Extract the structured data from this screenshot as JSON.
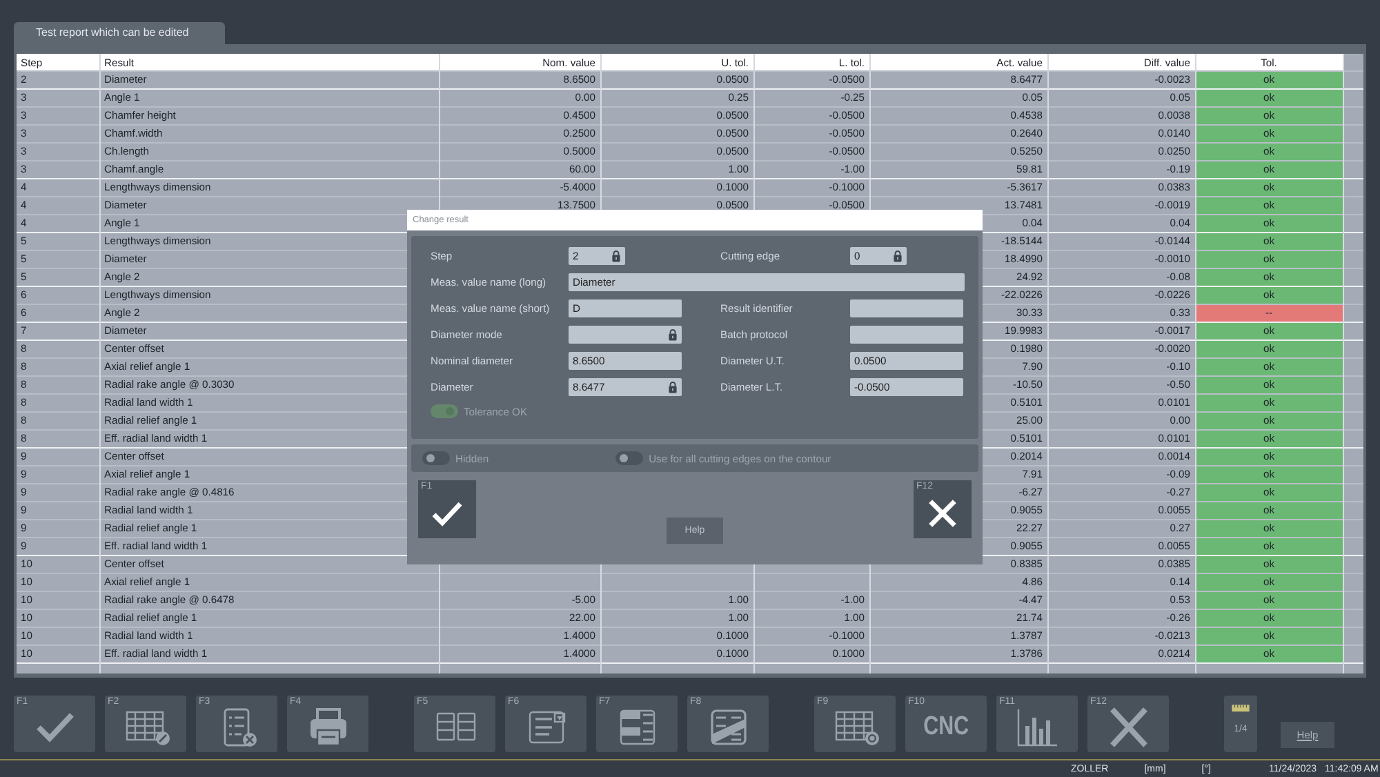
{
  "tab": {
    "label": "Test report which can be edited",
    "selected": true
  },
  "table": {
    "columns": [
      "Step",
      "Result",
      "Nom. value",
      "U. tol.",
      "L. tol.",
      "Act. value",
      "Diff. value",
      "Tol."
    ],
    "rows": [
      {
        "cells": [
          "2",
          "Diameter",
          "8.6500",
          "0.0500",
          "-0.0500",
          "8.6477",
          "-0.0023",
          "ok"
        ],
        "in_tolerance": true
      },
      {
        "cells": [
          "3",
          "Angle 1",
          "0.00",
          "0.25",
          "-0.25",
          "0.05",
          "0.05",
          "ok"
        ],
        "in_tolerance": true
      },
      {
        "cells": [
          "3",
          "Chamfer height",
          "0.4500",
          "0.0500",
          "-0.0500",
          "0.4538",
          "0.0038",
          "ok"
        ],
        "in_tolerance": true
      },
      {
        "cells": [
          "3",
          "Chamf.width",
          "0.2500",
          "0.0500",
          "-0.0500",
          "0.2640",
          "0.0140",
          "ok"
        ],
        "in_tolerance": true
      },
      {
        "cells": [
          "3",
          "Ch.length",
          "0.5000",
          "0.0500",
          "-0.0500",
          "0.5250",
          "0.0250",
          "ok"
        ],
        "in_tolerance": true
      },
      {
        "cells": [
          "3",
          "Chamf.angle",
          "60.00",
          "1.00",
          "-1.00",
          "59.81",
          "-0.19",
          "ok"
        ],
        "in_tolerance": true
      },
      {
        "cells": [
          "4",
          "Lengthways dimension",
          "-5.4000",
          "0.1000",
          "-0.1000",
          "-5.3617",
          "0.0383",
          "ok"
        ],
        "in_tolerance": true
      },
      {
        "cells": [
          "4",
          "Diameter",
          "13.7500",
          "0.0500",
          "-0.0500",
          "13.7481",
          "-0.0019",
          "ok"
        ],
        "in_tolerance": true
      },
      {
        "cells": [
          "4",
          "Angle 1",
          null,
          null,
          null,
          "0.04",
          "0.04",
          "ok"
        ],
        "in_tolerance": true
      },
      {
        "cells": [
          "5",
          "Lengthways dimension",
          null,
          null,
          null,
          "-18.5144",
          "-0.0144",
          "ok"
        ],
        "in_tolerance": true
      },
      {
        "cells": [
          "5",
          "Diameter",
          null,
          null,
          null,
          "18.4990",
          "-0.0010",
          "ok"
        ],
        "in_tolerance": true
      },
      {
        "cells": [
          "5",
          "Angle 2",
          null,
          null,
          null,
          "24.92",
          "-0.08",
          "ok"
        ],
        "in_tolerance": true
      },
      {
        "cells": [
          "6",
          "Lengthways dimension",
          null,
          null,
          null,
          "-22.0226",
          "-0.0226",
          "ok"
        ],
        "in_tolerance": true
      },
      {
        "cells": [
          "6",
          "Angle 2",
          null,
          null,
          null,
          "30.33",
          "0.33",
          "--"
        ],
        "in_tolerance": false
      },
      {
        "cells": [
          "7",
          "Diameter",
          null,
          null,
          null,
          "19.9983",
          "-0.0017",
          "ok"
        ],
        "in_tolerance": true
      },
      {
        "cells": [
          "8",
          "Center offset",
          null,
          null,
          null,
          "0.1980",
          "-0.0020",
          "ok"
        ],
        "in_tolerance": true
      },
      {
        "cells": [
          "8",
          "Axial relief angle 1",
          null,
          null,
          null,
          "7.90",
          "-0.10",
          "ok"
        ],
        "in_tolerance": true
      },
      {
        "cells": [
          "8",
          "Radial rake angle @ 0.3030",
          null,
          null,
          null,
          "-10.50",
          "-0.50",
          "ok"
        ],
        "in_tolerance": true
      },
      {
        "cells": [
          "8",
          "Radial land width 1",
          null,
          null,
          null,
          "0.5101",
          "0.0101",
          "ok"
        ],
        "in_tolerance": true
      },
      {
        "cells": [
          "8",
          "Radial relief angle 1",
          null,
          null,
          null,
          "25.00",
          "0.00",
          "ok"
        ],
        "in_tolerance": true
      },
      {
        "cells": [
          "8",
          "Eff. radial land width 1",
          null,
          null,
          null,
          "0.5101",
          "0.0101",
          "ok"
        ],
        "in_tolerance": true
      },
      {
        "cells": [
          "9",
          "Center offset",
          null,
          null,
          null,
          "0.2014",
          "0.0014",
          "ok"
        ],
        "in_tolerance": true
      },
      {
        "cells": [
          "9",
          "Axial relief angle 1",
          null,
          null,
          null,
          "7.91",
          "-0.09",
          "ok"
        ],
        "in_tolerance": true
      },
      {
        "cells": [
          "9",
          "Radial rake angle @ 0.4816",
          null,
          null,
          null,
          "-6.27",
          "-0.27",
          "ok"
        ],
        "in_tolerance": true
      },
      {
        "cells": [
          "9",
          "Radial land width 1",
          null,
          null,
          null,
          "0.9055",
          "0.0055",
          "ok"
        ],
        "in_tolerance": true
      },
      {
        "cells": [
          "9",
          "Radial relief angle 1",
          null,
          null,
          null,
          "22.27",
          "0.27",
          "ok"
        ],
        "in_tolerance": true
      },
      {
        "cells": [
          "9",
          "Eff. radial land width 1",
          null,
          null,
          null,
          "0.9055",
          "0.0055",
          "ok"
        ],
        "in_tolerance": true
      },
      {
        "cells": [
          "10",
          "Center offset",
          null,
          null,
          null,
          "0.8385",
          "0.0385",
          "ok"
        ],
        "in_tolerance": true
      },
      {
        "cells": [
          "10",
          "Axial relief angle 1",
          null,
          null,
          null,
          "4.86",
          "0.14",
          "ok"
        ],
        "in_tolerance": true
      },
      {
        "cells": [
          "10",
          "Radial rake angle @ 0.6478",
          "-5.00",
          "1.00",
          "-1.00",
          "-4.47",
          "0.53",
          "ok"
        ],
        "in_tolerance": true
      },
      {
        "cells": [
          "10",
          "Radial relief angle 1",
          "22.00",
          "1.00",
          "1.00",
          "21.74",
          "-0.26",
          "ok"
        ],
        "in_tolerance": true
      },
      {
        "cells": [
          "10",
          "Radial land width 1",
          "1.4000",
          "0.1000",
          "-0.1000",
          "1.3787",
          "-0.0213",
          "ok"
        ],
        "in_tolerance": true
      },
      {
        "cells": [
          "10",
          "Eff. radial land width 1",
          "1.4000",
          "0.1000",
          "0.1000",
          "1.3786",
          "0.0214",
          "ok"
        ],
        "in_tolerance": true
      }
    ]
  },
  "dialog": {
    "title": "Change result",
    "fields": [
      {
        "label": "Step",
        "value": "2",
        "locked": true,
        "kind": "narrow"
      },
      {
        "label": "Cutting edge",
        "value": "0",
        "locked": true,
        "kind": "narrow"
      },
      {
        "label": "Meas. value name (long)",
        "value": "Diameter",
        "locked": false,
        "kind": "wide"
      },
      {
        "label": "Meas. value name (short)",
        "value": "D",
        "locked": false,
        "kind": "normal"
      },
      {
        "label": "Result identifier",
        "locked": false,
        "kind": "normal"
      },
      {
        "label": "Diameter mode",
        "locked": true,
        "kind": "normal"
      },
      {
        "label": "Batch protocol",
        "locked": false,
        "kind": "normal"
      },
      {
        "label": "Nominal diameter",
        "value": "8.6500",
        "locked": false,
        "kind": "normal"
      },
      {
        "label": "Diameter U.T.",
        "value": "0.0500",
        "locked": false,
        "kind": "normal"
      },
      {
        "label": "Diameter",
        "value": "8.6477",
        "locked": true,
        "kind": "normal"
      },
      {
        "label": "Diameter L.T.",
        "value": "-0.0500",
        "locked": false,
        "kind": "normal"
      }
    ],
    "tolerance_toggle": {
      "label": "Tolerance OK",
      "on": true,
      "disabled": true
    },
    "toggles": [
      {
        "label": "Hidden",
        "on": false,
        "disabled": true
      },
      {
        "label": "Use for all cutting edges on the contour",
        "on": false,
        "disabled": true
      }
    ],
    "ok_key": "F1",
    "cancel_key": "F12",
    "help": "Help"
  },
  "toolbar": [
    {
      "key": "F1"
    },
    {
      "key": "F2"
    },
    {
      "key": "F3"
    },
    {
      "key": "F4"
    },
    {
      "key": "F5"
    },
    {
      "key": "F6"
    },
    {
      "key": "F7"
    },
    {
      "key": "F8"
    },
    {
      "key": "F9"
    },
    {
      "key": "F10",
      "text": "CNC"
    },
    {
      "key": "F11"
    },
    {
      "key": "F12"
    }
  ],
  "page_indicator": "1/4",
  "help_button": "Help",
  "status_bar": {
    "brand": "ZOLLER",
    "unit_length": "[mm]",
    "unit_angle": "[°]",
    "date": "11/24/2023",
    "time": "11:42:09 AM"
  }
}
